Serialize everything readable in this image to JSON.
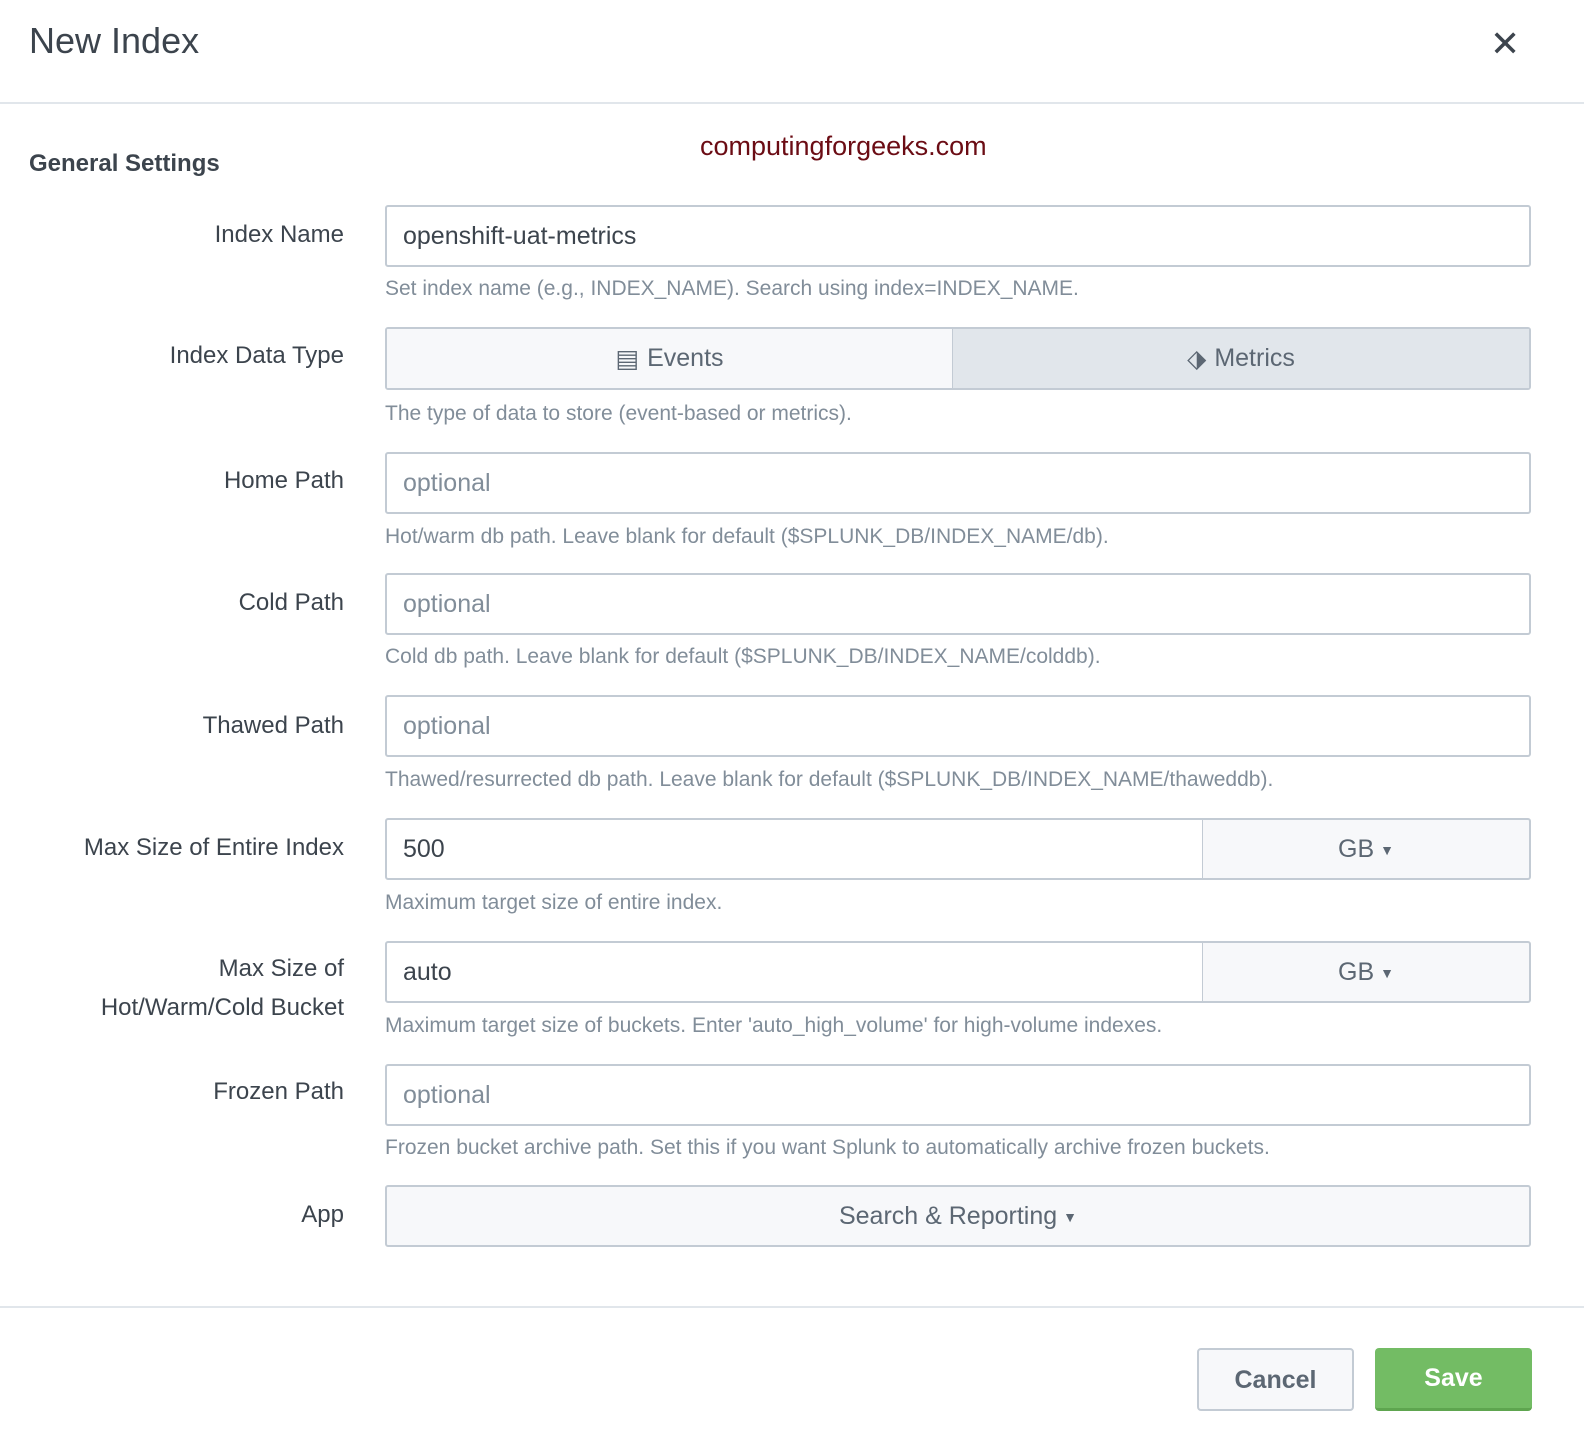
{
  "header": {
    "title": "New Index",
    "close_icon": "close-icon"
  },
  "watermark": "computingforgeeks.com",
  "section_title": "General Settings",
  "fields": {
    "index_name": {
      "label": "Index Name",
      "value": "openshift-uat-metrics",
      "help": "Set index name (e.g., INDEX_NAME). Search using index=INDEX_NAME."
    },
    "data_type": {
      "label": "Index Data Type",
      "options": [
        "Events",
        "Metrics"
      ],
      "selected": "Metrics",
      "help": "The type of data to store (event-based or metrics)."
    },
    "home_path": {
      "label": "Home Path",
      "placeholder": "optional",
      "help": "Hot/warm db path. Leave blank for default ($SPLUNK_DB/INDEX_NAME/db)."
    },
    "cold_path": {
      "label": "Cold Path",
      "placeholder": "optional",
      "help": "Cold db path. Leave blank for default ($SPLUNK_DB/INDEX_NAME/colddb)."
    },
    "thawed_path": {
      "label": "Thawed Path",
      "placeholder": "optional",
      "help": "Thawed/resurrected db path. Leave blank for default ($SPLUNK_DB/INDEX_NAME/thaweddb)."
    },
    "max_size": {
      "label": "Max Size of Entire Index",
      "value": "500",
      "unit": "GB",
      "help": "Maximum target size of entire index."
    },
    "bucket_size": {
      "label_line1": "Max Size of",
      "label_line2": "Hot/Warm/Cold Bucket",
      "value": "auto",
      "unit": "GB",
      "help": "Maximum target size of buckets. Enter 'auto_high_volume' for high-volume indexes."
    },
    "frozen_path": {
      "label": "Frozen Path",
      "placeholder": "optional",
      "help": "Frozen bucket archive path. Set this if you want Splunk to automatically archive frozen buckets."
    },
    "app": {
      "label": "App",
      "value": "Search & Reporting"
    }
  },
  "footer": {
    "cancel": "Cancel",
    "save": "Save"
  }
}
